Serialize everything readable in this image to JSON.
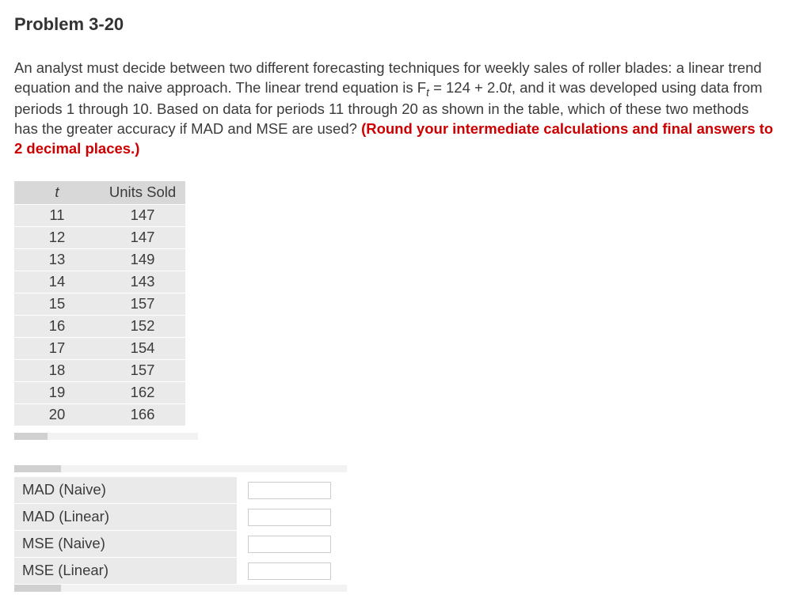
{
  "title": "Problem 3-20",
  "desc_part1": "An analyst must decide between two different forecasting techniques for weekly sales of roller blades: a linear trend equation and the naive approach. The linear trend equation is F",
  "desc_sub": "t",
  "desc_part2": " = 124 + 2.0",
  "desc_it": "t",
  "desc_part3": ", and it was developed using data from periods 1 through 10. Based on data for periods 11 through 20 as shown in the table, which of these two methods has the greater accuracy if MAD and MSE are used? ",
  "redtext": "(Round your intermediate calculations and final answers to 2 decimal places.)",
  "chart_data": {
    "type": "table",
    "columns": [
      "t",
      "Units Sold"
    ],
    "rows": [
      [
        11,
        147
      ],
      [
        12,
        147
      ],
      [
        13,
        149
      ],
      [
        14,
        143
      ],
      [
        15,
        157
      ],
      [
        16,
        152
      ],
      [
        17,
        154
      ],
      [
        18,
        157
      ],
      [
        19,
        162
      ],
      [
        20,
        166
      ]
    ]
  },
  "answer_labels": {
    "mad_naive": "MAD (Naive)",
    "mad_linear": "MAD (Linear)",
    "mse_naive": "MSE (Naive)",
    "mse_linear": "MSE (Linear)"
  }
}
